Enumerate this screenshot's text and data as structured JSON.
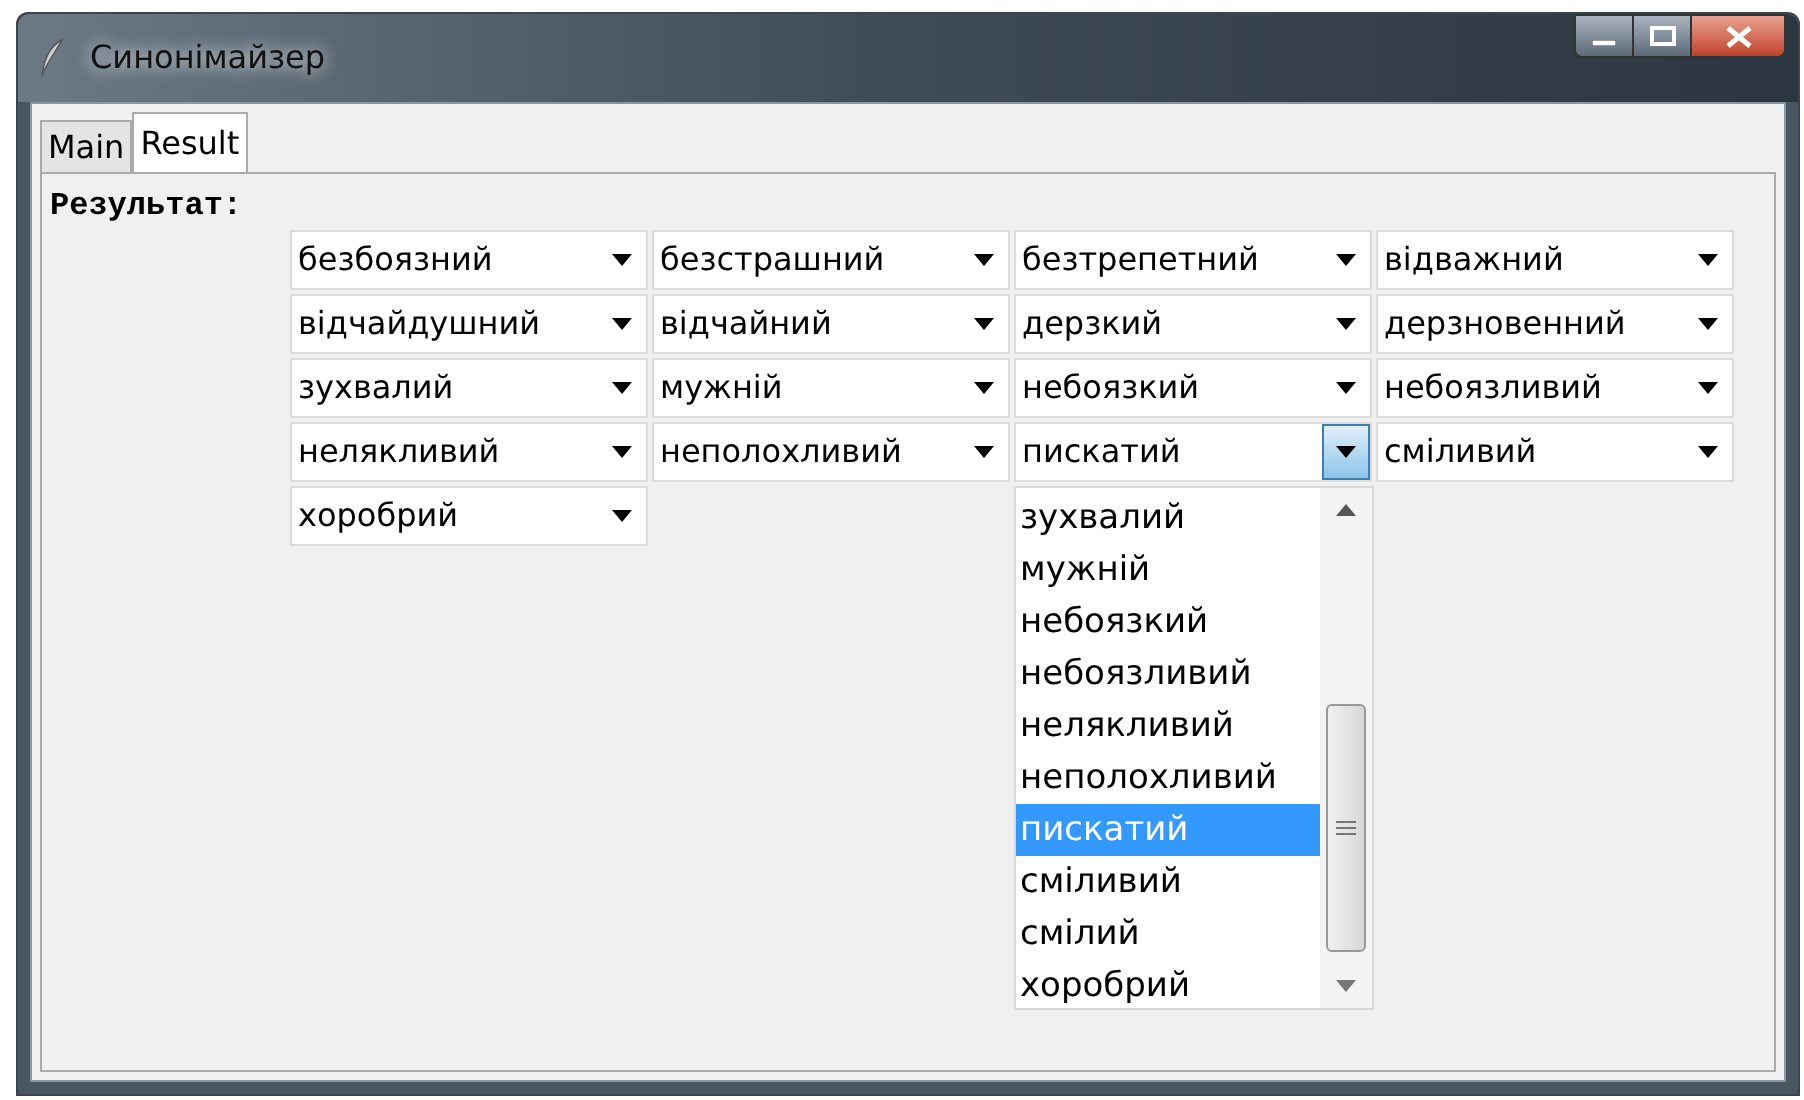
{
  "window": {
    "title": "Синонімайзер"
  },
  "tabs": [
    {
      "label": "Main",
      "selected": false
    },
    {
      "label": "Result",
      "selected": true
    }
  ],
  "result_label": "Результат:",
  "combos": [
    {
      "value": "безбоязний",
      "expanded": false
    },
    {
      "value": "безстрашний",
      "expanded": false
    },
    {
      "value": "безтрепетний",
      "expanded": false
    },
    {
      "value": "відважний",
      "expanded": false
    },
    {
      "value": "відчайдушний",
      "expanded": false
    },
    {
      "value": "відчайний",
      "expanded": false
    },
    {
      "value": "дерзкий",
      "expanded": false
    },
    {
      "value": "дерзновенний",
      "expanded": false
    },
    {
      "value": "зухвалий",
      "expanded": false
    },
    {
      "value": "мужній",
      "expanded": false
    },
    {
      "value": "небоязкий",
      "expanded": false
    },
    {
      "value": "небоязливий",
      "expanded": false
    },
    {
      "value": "нелякливий",
      "expanded": false
    },
    {
      "value": "неполохливий",
      "expanded": false
    },
    {
      "value": "пискатий",
      "expanded": true
    },
    {
      "value": "сміливий",
      "expanded": false
    },
    {
      "value": "хоробрий",
      "expanded": false
    }
  ],
  "dropdown": {
    "items": [
      {
        "label": "зухвалий",
        "selected": false
      },
      {
        "label": "мужній",
        "selected": false
      },
      {
        "label": "небоязкий",
        "selected": false
      },
      {
        "label": "небоязливий",
        "selected": false
      },
      {
        "label": "нелякливий",
        "selected": false
      },
      {
        "label": "неполохливий",
        "selected": false
      },
      {
        "label": "пискатий",
        "selected": true
      },
      {
        "label": "сміливий",
        "selected": false
      },
      {
        "label": "смілий",
        "selected": false
      },
      {
        "label": "хоробрий",
        "selected": false
      }
    ]
  }
}
